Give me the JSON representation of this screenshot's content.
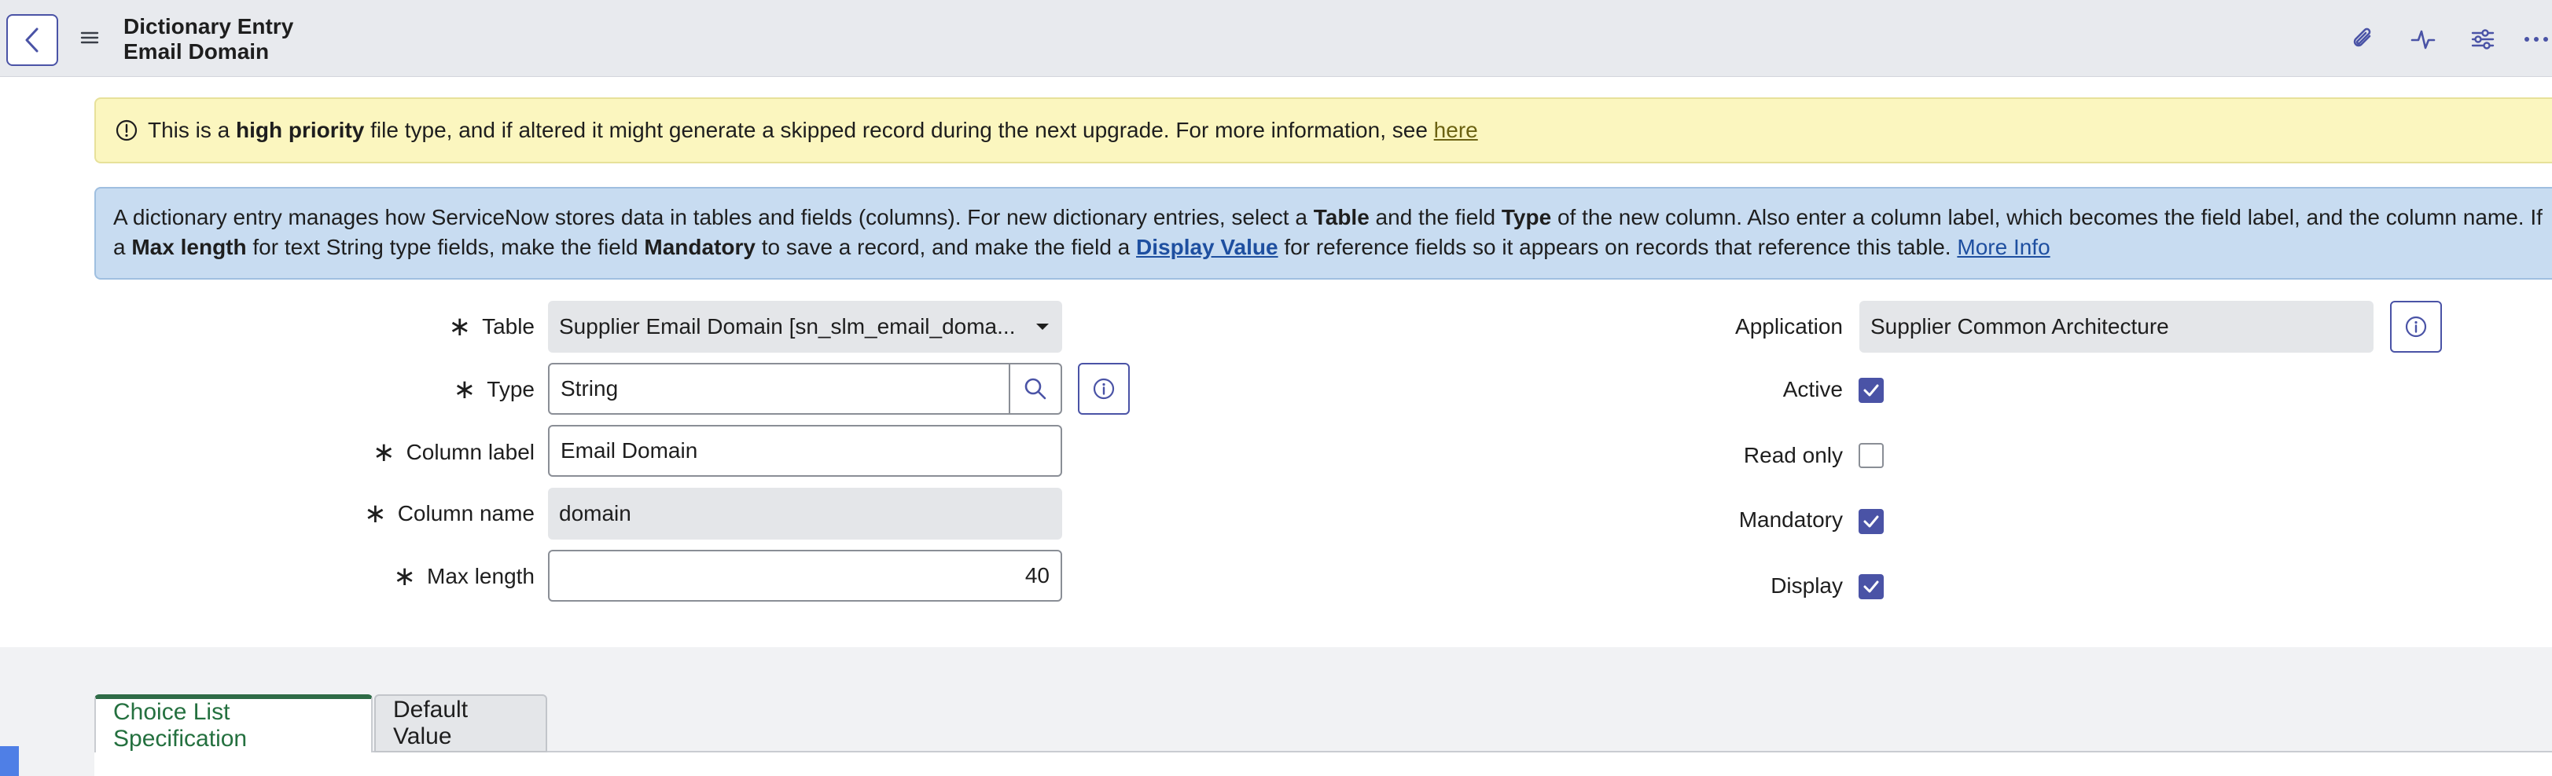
{
  "header": {
    "title_line1": "Dictionary Entry",
    "title_line2": "Email Domain",
    "icons": [
      "chevron-left-icon",
      "hamburger-menu-icon",
      "paperclip-icon",
      "activity-icon",
      "sliders-icon",
      "more-icon"
    ]
  },
  "warning_banner": {
    "text_before": "This is a ",
    "bold": "high priority",
    "text_after": " file type, and if altered it might generate a skipped record during the next upgrade. For more information, see ",
    "link": "here"
  },
  "info_banner": {
    "l1_a": "A dictionary entry manages how ServiceNow stores data in tables and fields (columns). For new dictionary entries, select a ",
    "l1_b": "Table",
    "l1_c": " and the field ",
    "l1_d": "Type",
    "l1_e": " of the new column. Also enter a column label, which becomes the field label, and the column name. If",
    "l2_a": "a ",
    "l2_b": "Max length",
    "l2_c": " for text String type fields, make the field ",
    "l2_d": "Mandatory",
    "l2_e": " to save a record, and make the field a ",
    "l2_link": "Display Value",
    "l2_f": " for reference fields so it appears on records that reference this table. ",
    "l2_more": "More Info"
  },
  "form": {
    "required_mark": "∗",
    "table": {
      "label": "Table",
      "value": "Supplier Email Domain [sn_slm_email_doma..."
    },
    "type": {
      "label": "Type",
      "value": "String"
    },
    "column_label": {
      "label": "Column label",
      "value": "Email Domain"
    },
    "column_name": {
      "label": "Column name",
      "value": "domain"
    },
    "max_length": {
      "label": "Max length",
      "value": "40"
    },
    "application": {
      "label": "Application",
      "value": "Supplier Common Architecture"
    },
    "active": {
      "label": "Active",
      "checked": true
    },
    "read_only": {
      "label": "Read only",
      "checked": false
    },
    "mandatory": {
      "label": "Mandatory",
      "checked": true
    },
    "display": {
      "label": "Display",
      "checked": true
    }
  },
  "tabs": [
    {
      "label": "Choice List Specification",
      "active": true
    },
    {
      "label": "Default Value",
      "active": false
    }
  ],
  "colors": {
    "accent": "#4a53a6",
    "header_bg": "#e8eaee",
    "warning_bg": "#fbf6bf",
    "info_bg": "#c8dcf1",
    "active_tab_text": "#24703f"
  }
}
